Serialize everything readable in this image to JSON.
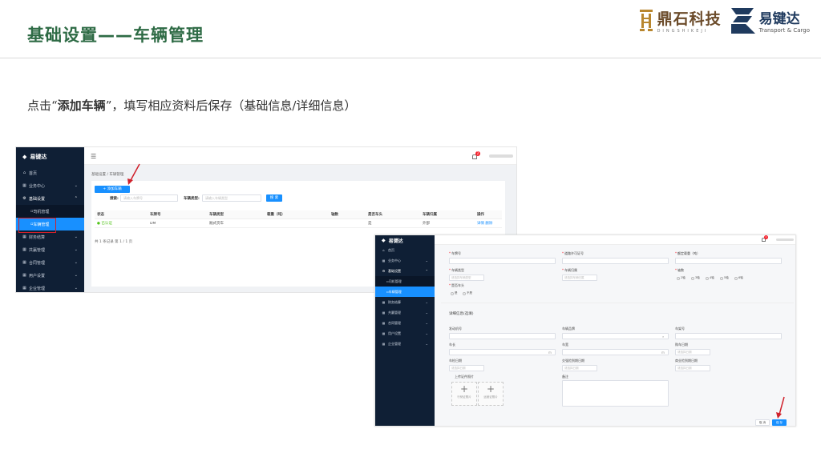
{
  "slide": {
    "title": "基础设置——车辆管理",
    "instruction_pre": "点击“",
    "instruction_bold": "添加车辆",
    "instruction_post": "”，填写相应资料后保存（基础信息/详细信息）"
  },
  "logos": {
    "dingshi_cn": "鼎石科技",
    "dingshi_en": "DINGSHIKEJI",
    "yjd_cn": "易键达",
    "yjd_en": "Transport & Cargo"
  },
  "app": {
    "brand": "易键达",
    "menu": {
      "home": "首页",
      "business": "业务中心",
      "basic": "基础设置",
      "driver": "司机管理",
      "vehicle": "车辆管理",
      "finance": "财务结算",
      "ship": "共赢管理",
      "contract": "合同管理",
      "user": "用户设置",
      "enterprise": "企业管理"
    },
    "notification_count": "2"
  },
  "list_page": {
    "breadcrumb": "基础设置 / 车辆管理",
    "add_button": "+ 添加车辆",
    "search_label": "搜索:",
    "search_placeholder": "请输入车牌号",
    "type_label": "车辆类型:",
    "type_placeholder": "请输入车辆类型",
    "search_button": "搜 索",
    "columns": [
      "状态",
      "车牌号",
      "车辆类型",
      "载重（吨）",
      "轴数",
      "是否车头",
      "车辆归属",
      "操作"
    ],
    "row": {
      "status": "● 已认证",
      "plate": "DM",
      "type": "厢式货车",
      "load": "",
      "axles": "",
      "is_head": "是",
      "owner": "外部",
      "actions": "详情  删除"
    },
    "pager": "共 1 条记录 第 1 / 1 页"
  },
  "form_page": {
    "basic_fields": {
      "plate": "车牌号",
      "license": "道路许可证号",
      "capacity": "额定载重（吨）",
      "type": "车辆类型",
      "owner": "车辆归属",
      "axles": "轴数",
      "is_head": "是否车头"
    },
    "type_placeholder": "请选择车辆类型",
    "owner_placeholder": "请选择车辆归属",
    "axle_options": [
      "2轴",
      "3轴",
      "4轴",
      "5轴",
      "6轴"
    ],
    "is_head_options": [
      "是",
      "不是"
    ],
    "detail_title": "详细信息(选填)",
    "detail_fields": {
      "engine": "发动机号",
      "brand": "车辆品牌",
      "model": "车架号",
      "length": "车长",
      "width": "车宽",
      "purchase": "购车日期",
      "register": "车检日期",
      "insurance_exp": "交强险到期日期",
      "commercial_exp": "商业险到期日期",
      "upload": "上传证件照片",
      "remark": "备注"
    },
    "date_placeholder": "请选择日期",
    "upload_front": "行驶证照片",
    "upload_back": "运营证照片",
    "cancel_button": "取 消",
    "save_button": "保 存"
  }
}
